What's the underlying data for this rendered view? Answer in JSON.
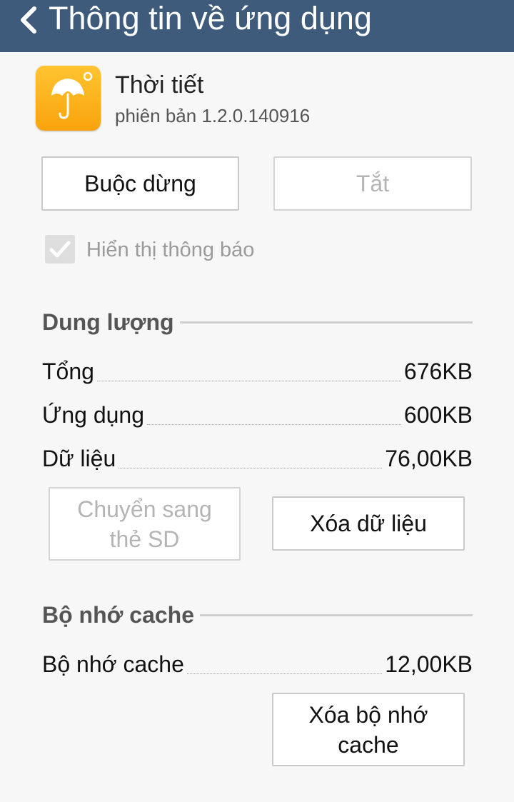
{
  "header": {
    "back_icon": "chevron-left-icon",
    "title": "Thông tin về ứng dụng"
  },
  "app": {
    "icon": "umbrella-icon",
    "icon_color": "#f9b51a",
    "name": "Thời tiết",
    "version": "phiên bản 1.2.0.140916"
  },
  "actions": {
    "force_stop": "Buộc dừng",
    "disable": "Tắt"
  },
  "notifications": {
    "label": "Hiển thị thông báo",
    "checked": true,
    "enabled": false
  },
  "storage": {
    "title": "Dung lượng",
    "rows": [
      {
        "label": "Tổng",
        "value": "676KB"
      },
      {
        "label": "Ứng dụng",
        "value": "600KB"
      },
      {
        "label": "Dữ liệu",
        "value": "76,00KB"
      }
    ],
    "move_to_sd": {
      "line1": "Chuyển sang",
      "line2": "thẻ SD"
    },
    "clear_data": "Xóa dữ liệu"
  },
  "cache": {
    "title": "Bộ nhớ cache",
    "row": {
      "label": "Bộ nhớ cache",
      "value": "12,00KB"
    },
    "clear_cache": {
      "line1": "Xóa bộ nhớ",
      "line2": "cache"
    }
  },
  "colors": {
    "header_bg": "#3f5b7c",
    "page_bg": "#f7f7f7",
    "disabled_text": "#b4b4b4"
  }
}
